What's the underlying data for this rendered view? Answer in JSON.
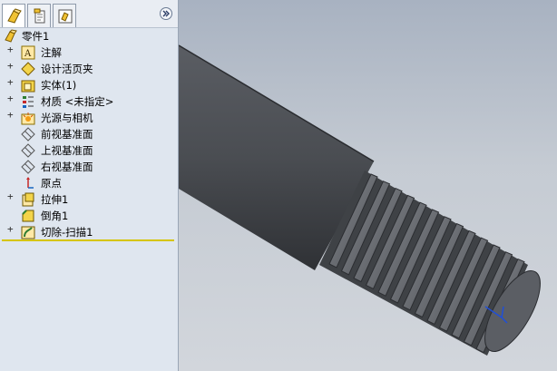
{
  "feature_tree": {
    "tabs": [
      {
        "name": "featuremanager-tab",
        "icon": "featuremanager-icon"
      },
      {
        "name": "propertymanager-tab",
        "icon": "propertymanager-icon"
      },
      {
        "name": "configurationmanager-tab",
        "icon": "configurationmanager-icon"
      }
    ],
    "expand_icon": "double-chevron-right-icon",
    "root": {
      "label": "零件1",
      "icon": "part-icon"
    },
    "items": [
      {
        "label": "注解",
        "icon": "annotations-icon",
        "expandable": true
      },
      {
        "label": "设计活页夹",
        "icon": "design-binder-icon",
        "expandable": true
      },
      {
        "label": "实体(1)",
        "icon": "solid-bodies-icon",
        "expandable": true
      },
      {
        "label": "材质 <未指定>",
        "icon": "material-icon",
        "expandable": true
      },
      {
        "label": "光源与相机",
        "icon": "lights-cameras-icon",
        "expandable": true
      },
      {
        "label": "前视基准面",
        "icon": "plane-icon",
        "expandable": false
      },
      {
        "label": "上视基准面",
        "icon": "plane-icon",
        "expandable": false
      },
      {
        "label": "右视基准面",
        "icon": "plane-icon",
        "expandable": false
      },
      {
        "label": "原点",
        "icon": "origin-icon",
        "expandable": false
      },
      {
        "label": "拉伸1",
        "icon": "extrude-icon",
        "expandable": true
      },
      {
        "label": "倒角1",
        "icon": "chamfer-icon",
        "expandable": false
      },
      {
        "label": "切除-扫描1",
        "icon": "cut-sweep-icon",
        "expandable": true
      }
    ]
  },
  "viewport": {
    "model": "threaded-rod",
    "colors": {
      "background_top": "#a8b2c1",
      "background_bottom": "#d2d6dc",
      "body": "#4a4d52",
      "rollback_bar": "#d6c500"
    }
  }
}
